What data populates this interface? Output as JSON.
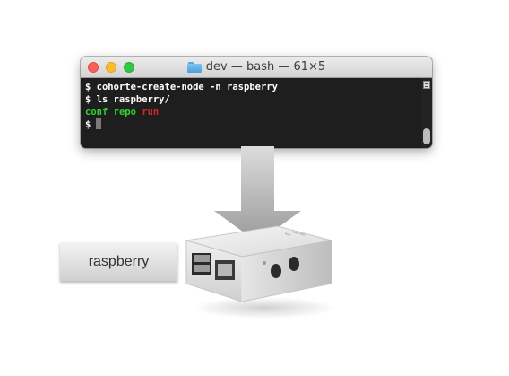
{
  "terminal": {
    "title": "dev — bash — 61×5",
    "lines": {
      "line1": "$ cohorte-create-node -n raspberry",
      "line2": "$ ls raspberry/",
      "line3": {
        "conf": "conf",
        "repo": "repo",
        "run": "run"
      },
      "prompt": "$"
    }
  },
  "label": {
    "text": "raspberry"
  },
  "colors": {
    "dir_green": "#2fd12f",
    "exec_red": "#d12626",
    "terminal_bg": "#1e1e1e"
  },
  "icons": {
    "title_icon": "folder-icon",
    "arrow": "down-arrow-icon",
    "device": "raspberry-pi-case-image"
  }
}
